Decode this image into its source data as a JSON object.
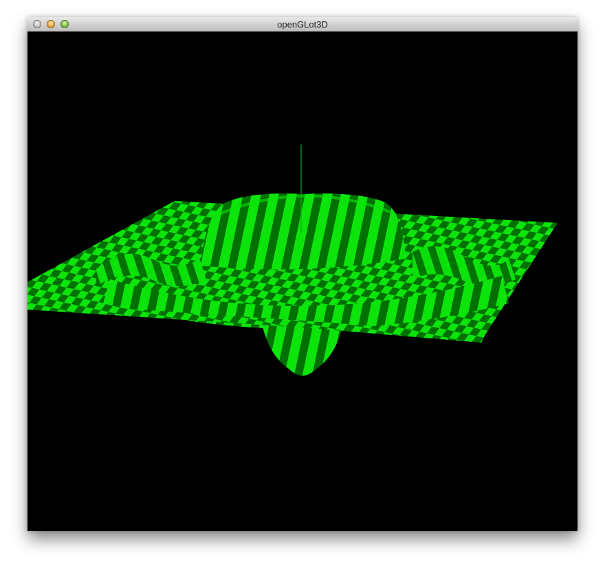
{
  "window": {
    "title": "openGLot3D",
    "buttons": {
      "close_icon": "close-icon",
      "minimize_icon": "minimize-icon",
      "zoom_icon": "zoom-icon"
    }
  },
  "scene": {
    "background": "#000000",
    "surface_color_light": "#0ce40c",
    "surface_color_dark": "#007000",
    "axis_color": "#10b010"
  }
}
